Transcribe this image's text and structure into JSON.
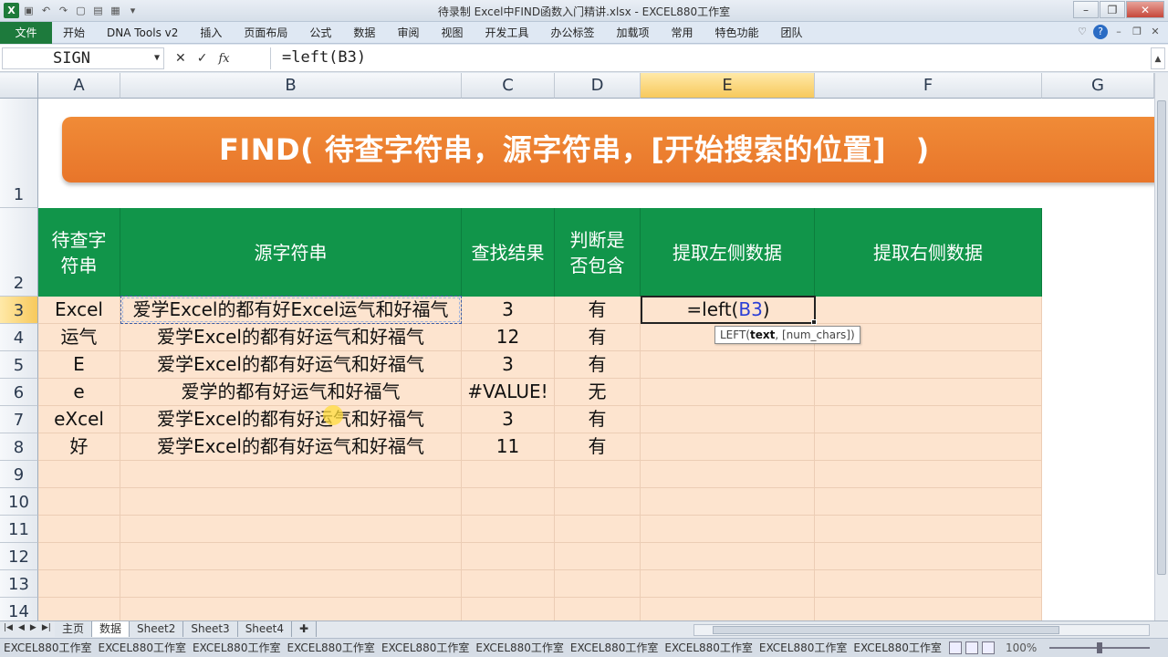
{
  "window": {
    "title": "待录制 Excel中FIND函数入门精讲.xlsx - EXCEL880工作室"
  },
  "ribbon": {
    "file_tab": "文件",
    "tabs": [
      "开始",
      "DNA Tools v2",
      "插入",
      "页面布局",
      "公式",
      "数据",
      "审阅",
      "视图",
      "开发工具",
      "办公标签",
      "加载项",
      "常用",
      "特色功能",
      "团队"
    ]
  },
  "formula_bar": {
    "name_box": "SIGN",
    "formula": "=left(B3)"
  },
  "columns": [
    "A",
    "B",
    "C",
    "D",
    "E",
    "F",
    "G"
  ],
  "selected_column": "E",
  "rows": [
    "1",
    "2",
    "3",
    "4",
    "5",
    "6",
    "7",
    "8",
    "9",
    "10",
    "11",
    "12",
    "13",
    "14"
  ],
  "selected_row": "3",
  "banner": "FIND( 待查字符串，源字符串，[开始搜索的位置]　)",
  "table_header": {
    "a": "待查字符串",
    "b": "源字符串",
    "c": "查找结果",
    "d": "判断是否包含",
    "e": "提取左侧数据",
    "f": "提取右侧数据"
  },
  "table_rows": [
    {
      "a": "Excel",
      "b": "爱学Excel的都有好Excel运气和好福气",
      "c": "3",
      "d": "有"
    },
    {
      "a": "运气",
      "b": "爱学Excel的都有好运气和好福气",
      "c": "12",
      "d": "有"
    },
    {
      "a": "E",
      "b": "爱学Excel的都有好运气和好福气",
      "c": "3",
      "d": "有"
    },
    {
      "a": "e",
      "b": "爱学的都有好运气和好福气",
      "c": "#VALUE!",
      "d": "无"
    },
    {
      "a": "eXcel",
      "b": "爱学Excel的都有好运气和好福气",
      "c": "3",
      "d": "有"
    },
    {
      "a": "好",
      "b": "爱学Excel的都有好运气和好福气",
      "c": "11",
      "d": "有"
    }
  ],
  "active_cell": {
    "prefix": "=left(",
    "ref": "B3",
    "suffix": ")"
  },
  "tooltip": {
    "func": "LEFT(",
    "arg1": "text",
    "rest": ", [num_chars])"
  },
  "sheets": [
    "主页",
    "数据",
    "Sheet2",
    "Sheet3",
    "Sheet4"
  ],
  "active_sheet": "数据",
  "status": {
    "items": [
      "EXCEL880工作室",
      "EXCEL880工作室",
      "EXCEL880工作室",
      "EXCEL880工作室",
      "EXCEL880工作室",
      "EXCEL880工作室",
      "EXCEL880工作室",
      "EXCEL880工作室",
      "EXCEL880工作室",
      "EXCEL880工作室"
    ],
    "zoom": "100%"
  }
}
